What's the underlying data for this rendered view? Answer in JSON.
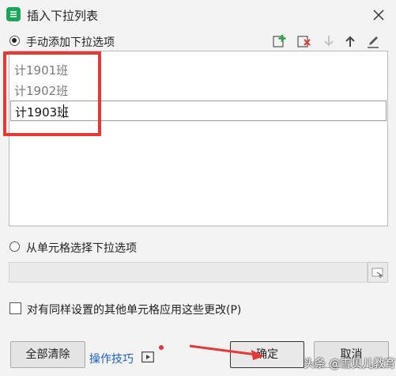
{
  "dialog": {
    "title": "插入下拉列表",
    "close_icon": "close-icon"
  },
  "manual_option": {
    "label": "手动添加下拉选项",
    "selected": true
  },
  "toolbar": {
    "icons": [
      "add-item-icon",
      "delete-item-icon",
      "move-down-icon",
      "move-up-icon",
      "edit-icon"
    ]
  },
  "list": {
    "items": [
      "计1901班",
      "计1902班",
      "计1903班"
    ],
    "editing_index": 2
  },
  "cell_option": {
    "label": "从单元格选择下拉选项",
    "selected": false,
    "range_value": ""
  },
  "apply_checkbox": {
    "label": "对有同样设置的其他单元格应用这些更改(P)",
    "checked": false
  },
  "buttons": {
    "clear_all": "全部清除",
    "tips_link": "操作技巧",
    "ok": "确定",
    "cancel": "取消"
  },
  "watermark": "头条 @雪贝儿教育",
  "colors": {
    "accent_green": "#1aa55a",
    "annotation_red": "#e53935",
    "link_blue": "#1b5fcc"
  }
}
